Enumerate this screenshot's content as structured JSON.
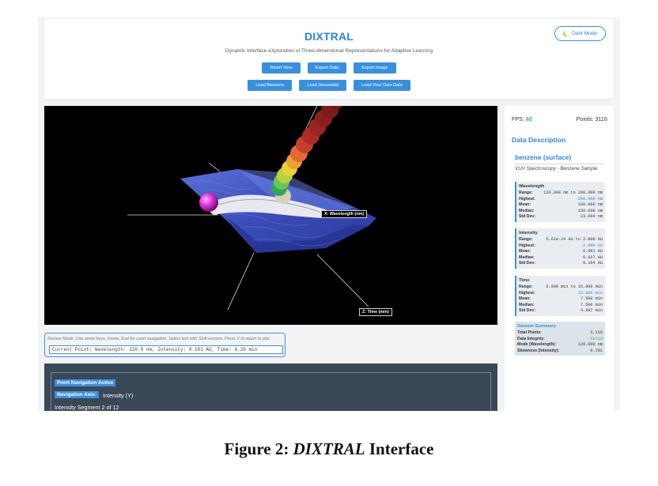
{
  "header": {
    "title": "DIXTRAL",
    "subtitle": "Dynamic Interface eXploration of Three-dimensional Representations for Adaptive Learning",
    "dark_mode_label": "Dark Mode",
    "buttons_row1": [
      "Reset View",
      "Export Data",
      "Export Image"
    ],
    "buttons_row2": [
      "Load Benzene",
      "Load Sinusoidal",
      "Load Your Own Data"
    ]
  },
  "viewer": {
    "axis_x_label": "X: Wavelength (nm)",
    "axis_z_label": "Z: Time (min)"
  },
  "review": {
    "note": "Review Mode: Use arrow keys, Home, End for caret navigation. Select text with Shift+arrows. Press V to return to plot.",
    "current_point": "Current Point: Wavelength: 120.0 nm, Intensity: 0.101 AU, Time: 6.20 min"
  },
  "navigation": {
    "status_badge": "Point Navigation Active",
    "axis_badge": "Navigation Axis:",
    "axis_value": "Intensity (Y)",
    "segment": "Intensity Segment 2 of 12"
  },
  "side": {
    "fps_label": "FPS:",
    "fps_value": "60",
    "points_label": "Points: 3116",
    "section_title": "Data Description",
    "dataset_name": "benzene (surface)",
    "dataset_description": "VUV Spectroscopy - Benzene Sample",
    "wavelength": {
      "title": "Wavelength",
      "range": "120.000 nm to 200.000 nm",
      "highest": "200.000 nm",
      "mean": "160.000 nm",
      "median": "160.000 nm",
      "std": "23.664 nm"
    },
    "intensity": {
      "title": "Intensity",
      "range": "5.62e-24 AU to 2.000 AU",
      "highest": "2.000 AU",
      "mean": "0.061 AU",
      "median": "0.027 AU",
      "std": "0.164 AU"
    },
    "time": {
      "title": "Time",
      "range": "0.000 min to 15.000 min",
      "highest": "15.000 min",
      "mean": "7.500 min",
      "median": "7.500 min",
      "std": "4.387 min"
    },
    "labels": {
      "range": "Range:",
      "highest": "Highest:",
      "mean": "Mean:",
      "median": "Median:",
      "std": "Std Dev:"
    },
    "summary": {
      "title": "Dataset Summary",
      "total_points_label": "Total Points:",
      "total_points": "3,116",
      "integrity_label": "Data Integrity:",
      "integrity": "Valid",
      "mode_label": "Mode (Wavelength):",
      "mode": "120.000 nm",
      "skewness_label": "Skewness (Intensity):",
      "skewness": "6.701"
    }
  },
  "caption": {
    "prefix": "Figure 2: ",
    "name": "DIXTRAL",
    "suffix": " Interface"
  },
  "colors": {
    "accent": "#3a8fdc",
    "title_blue": "#2f86d6",
    "fps_green": "#37b24d",
    "nav_panel": "#3a4755"
  }
}
